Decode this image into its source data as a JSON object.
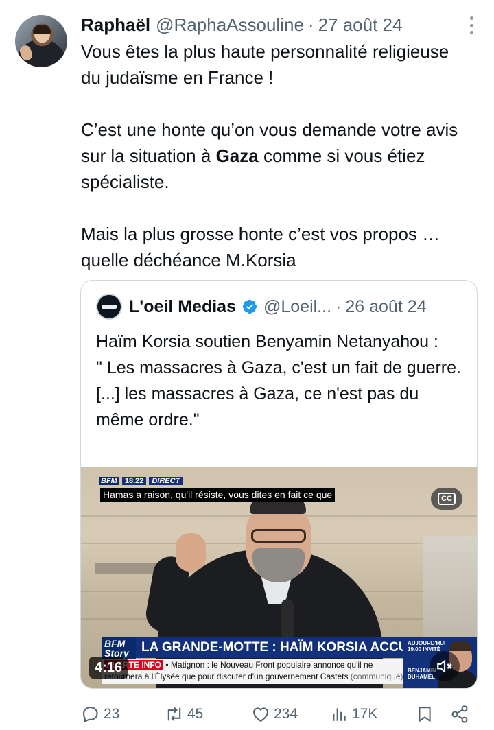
{
  "post": {
    "author_name": "Raphaël",
    "author_handle": "@RaphaAssouline",
    "separator": "·",
    "date": "27 août 24",
    "paragraph1": "Vous êtes la plus haute personnalité religieuse du judaïsme en France !",
    "paragraph2_before": "C’est une honte qu’on vous demande votre avis sur la situation à ",
    "paragraph2_bold": "Gaza",
    "paragraph2_after": " comme si vous étiez spécialiste.",
    "paragraph3": "Mais la plus grosse honte c’est vos propos … quelle déchéance M.Korsia"
  },
  "quote": {
    "author_name": "L'oeil Medias",
    "author_handle": "@Loeil...",
    "separator": "·",
    "date": "26 août 24",
    "line1": "Haïm Korsia soutien Benyamin Netanyahou  :",
    "line2": "\" Les massacres à Gaza, c'est un fait de guerre.[...] les massacres à Gaza, ce n'est pas du même ordre.\"",
    "video": {
      "channel": "BFM",
      "time": "18.22",
      "live_label": "DIRECT",
      "subtitle": "Hamas a raison, qu'il résiste, vous dites en fait ce que",
      "cc_label": "CC",
      "banner_channel": "BFM Story",
      "headline": "LA GRANDE-MOTTE : HAÏM KORSIA ACCUSE LFI",
      "ticker_alert": "ALERTE INFO",
      "ticker_text": " ▪ Matignon : le Nouveau Front populaire annonce qu'il ne retournera à l'Élysée que pour discuter d'un gouvernement Castets ",
      "ticker_muted": "(communiqué)",
      "corner_label": "AUJOURD'HUI 19.00 INVITÉ",
      "corner_name": "BENJAMIN DUHAMEL",
      "duration": "4:16"
    }
  },
  "actions": {
    "replies": "23",
    "reposts": "45",
    "likes": "234",
    "views": "17K"
  },
  "colors": {
    "text": "#0f1419",
    "muted": "#536471",
    "verified": "#1d9bf0",
    "border": "#cfd9de"
  }
}
